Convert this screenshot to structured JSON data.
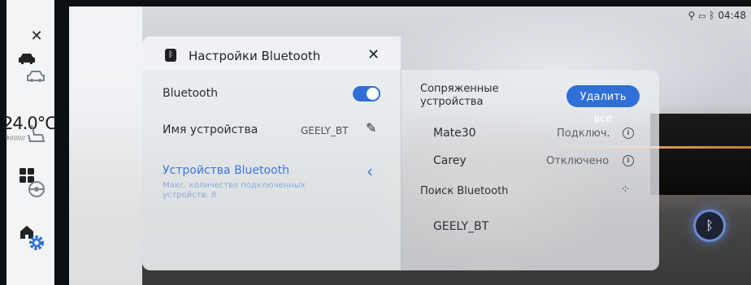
{
  "status_bar": {
    "time": "04:48",
    "icons": [
      "usb-icon",
      "battery-icon",
      "bluetooth-icon"
    ]
  },
  "rail": {
    "temperature": "24.0°C",
    "icons": [
      "car-icon",
      "apps-grid-icon",
      "home-icon"
    ]
  },
  "sidebar": {
    "items": [
      {
        "icon": "close-icon"
      },
      {
        "icon": "vehicle-settings-icon"
      },
      {
        "icon": "seat-icon"
      },
      {
        "icon": "steering-wheel-icon"
      },
      {
        "icon": "gear-icon",
        "active": true
      }
    ]
  },
  "dialog": {
    "title": "Настройки Bluetooth",
    "close_glyph": "✕",
    "bluetooth_label": "Bluetooth",
    "bluetooth_enabled": true,
    "device_name_label": "Имя устройства",
    "device_name_value": "GEELY_BT",
    "devices_section_label": "Устройства Bluetooth",
    "devices_section_hint": "Макс. количество подключенных устройств: 8"
  },
  "paired": {
    "header": "Сопряженные устройства",
    "delete_all": "Удалить все",
    "devices": [
      {
        "name": "Mate30",
        "status": "Подключ."
      },
      {
        "name": "Carey",
        "status": "Отключено"
      }
    ]
  },
  "search": {
    "label": "Поиск Bluetooth",
    "found": [
      {
        "name": "GEELY_BT"
      }
    ]
  },
  "colors": {
    "accent": "#2f6fd8",
    "text": "#2a2f36",
    "muted": "#7d828b"
  }
}
